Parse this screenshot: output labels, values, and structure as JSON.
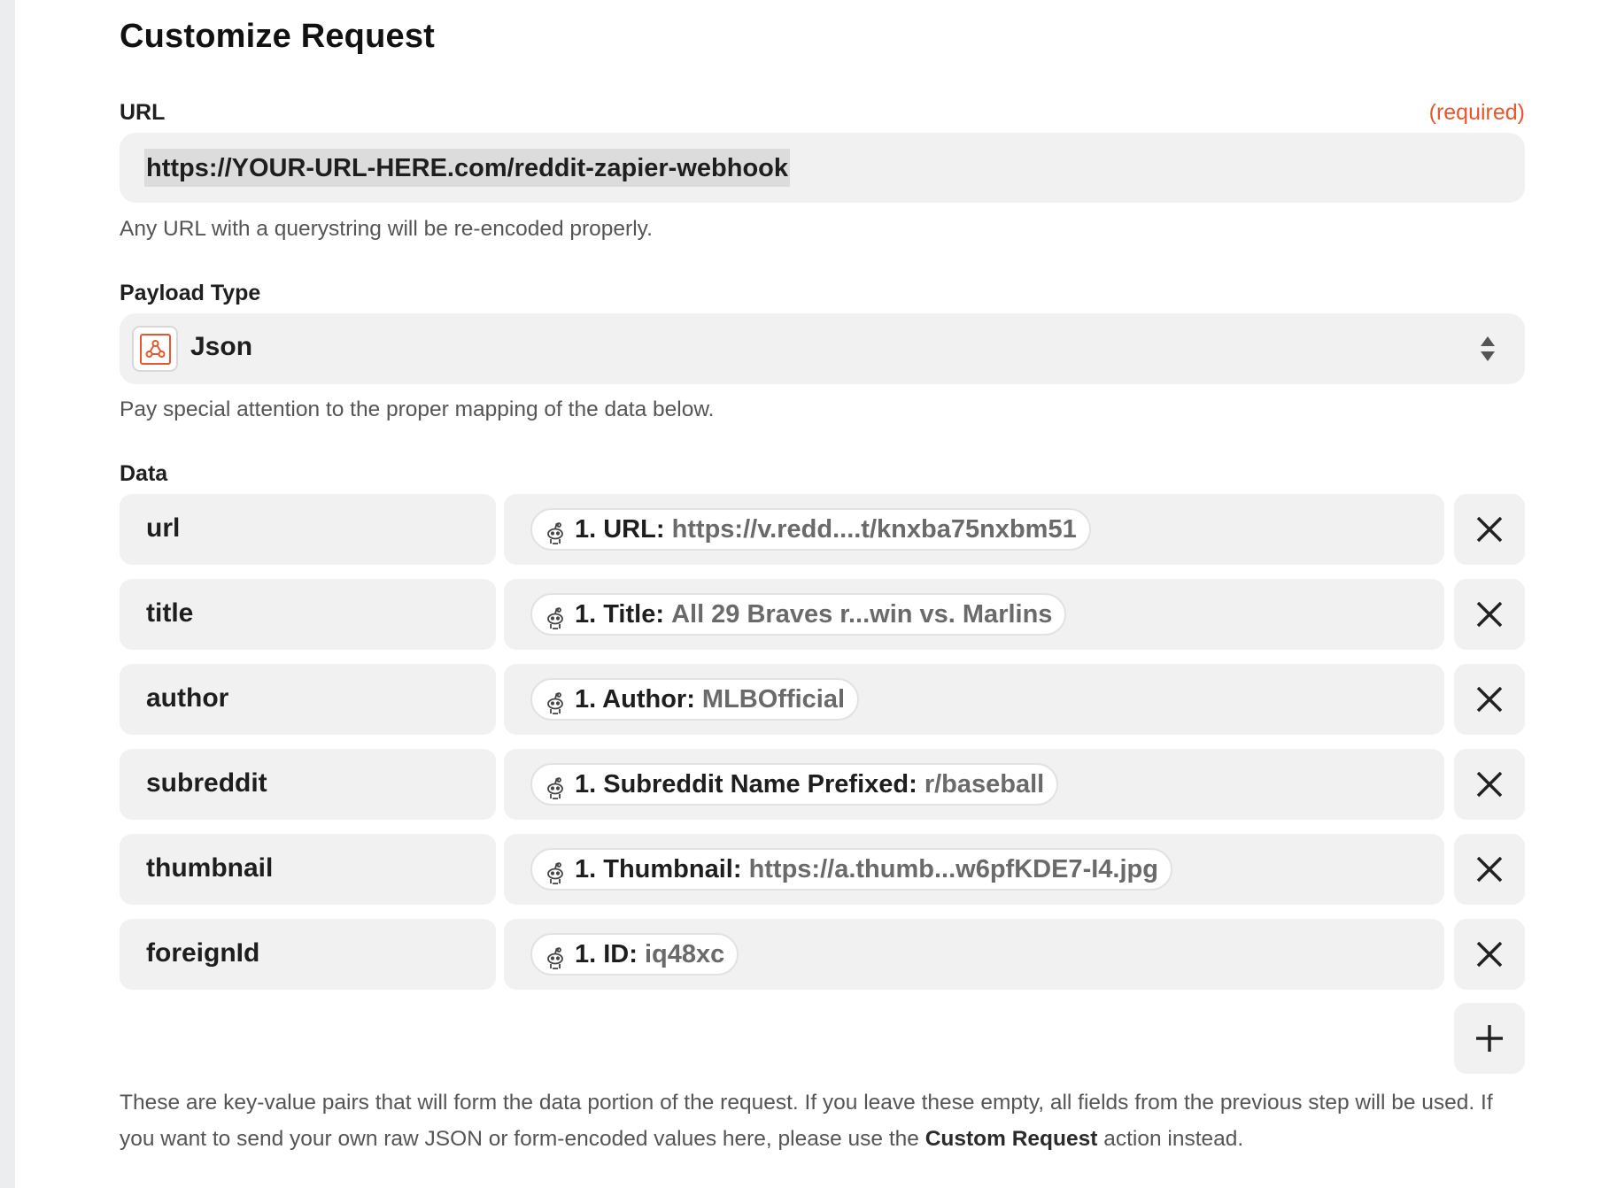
{
  "page_title": "Customize Request",
  "url_field": {
    "label": "URL",
    "required": "(required)",
    "value": "https://YOUR-URL-HERE.com/reddit-zapier-webhook",
    "help": "Any URL with a querystring will be re-encoded properly."
  },
  "payload_type": {
    "label": "Payload Type",
    "value": "Json",
    "icon": "webhook-icon",
    "help": "Pay special attention to the proper mapping of the data below."
  },
  "data": {
    "label": "Data",
    "rows": [
      {
        "key": "url",
        "field_label": "1. URL:",
        "field_value": "https://v.redd....t/knxba75nxbm51"
      },
      {
        "key": "title",
        "field_label": "1. Title:",
        "field_value": "All 29 Braves r...win vs. Marlins"
      },
      {
        "key": "author",
        "field_label": "1. Author:",
        "field_value": "MLBOfficial"
      },
      {
        "key": "subreddit",
        "field_label": "1. Subreddit Name Prefixed:",
        "field_value": "r/baseball"
      },
      {
        "key": "thumbnail",
        "field_label": "1. Thumbnail:",
        "field_value": "https://a.thumb...w6pfKDE7-I4.jpg"
      },
      {
        "key": "foreignId",
        "field_label": "1. ID:",
        "field_value": "iq48xc"
      }
    ],
    "help_part1": "These are key-value pairs that will form the data portion of the request. If you leave these empty, all fields from the previous step will be used. If you want to send your own raw JSON or form-encoded values here, please use the ",
    "help_bold": "Custom Request",
    "help_part2": " action instead."
  },
  "colors": {
    "accent": "#e8562a",
    "field_bg": "#f1f1f1",
    "help_text": "#555555"
  }
}
